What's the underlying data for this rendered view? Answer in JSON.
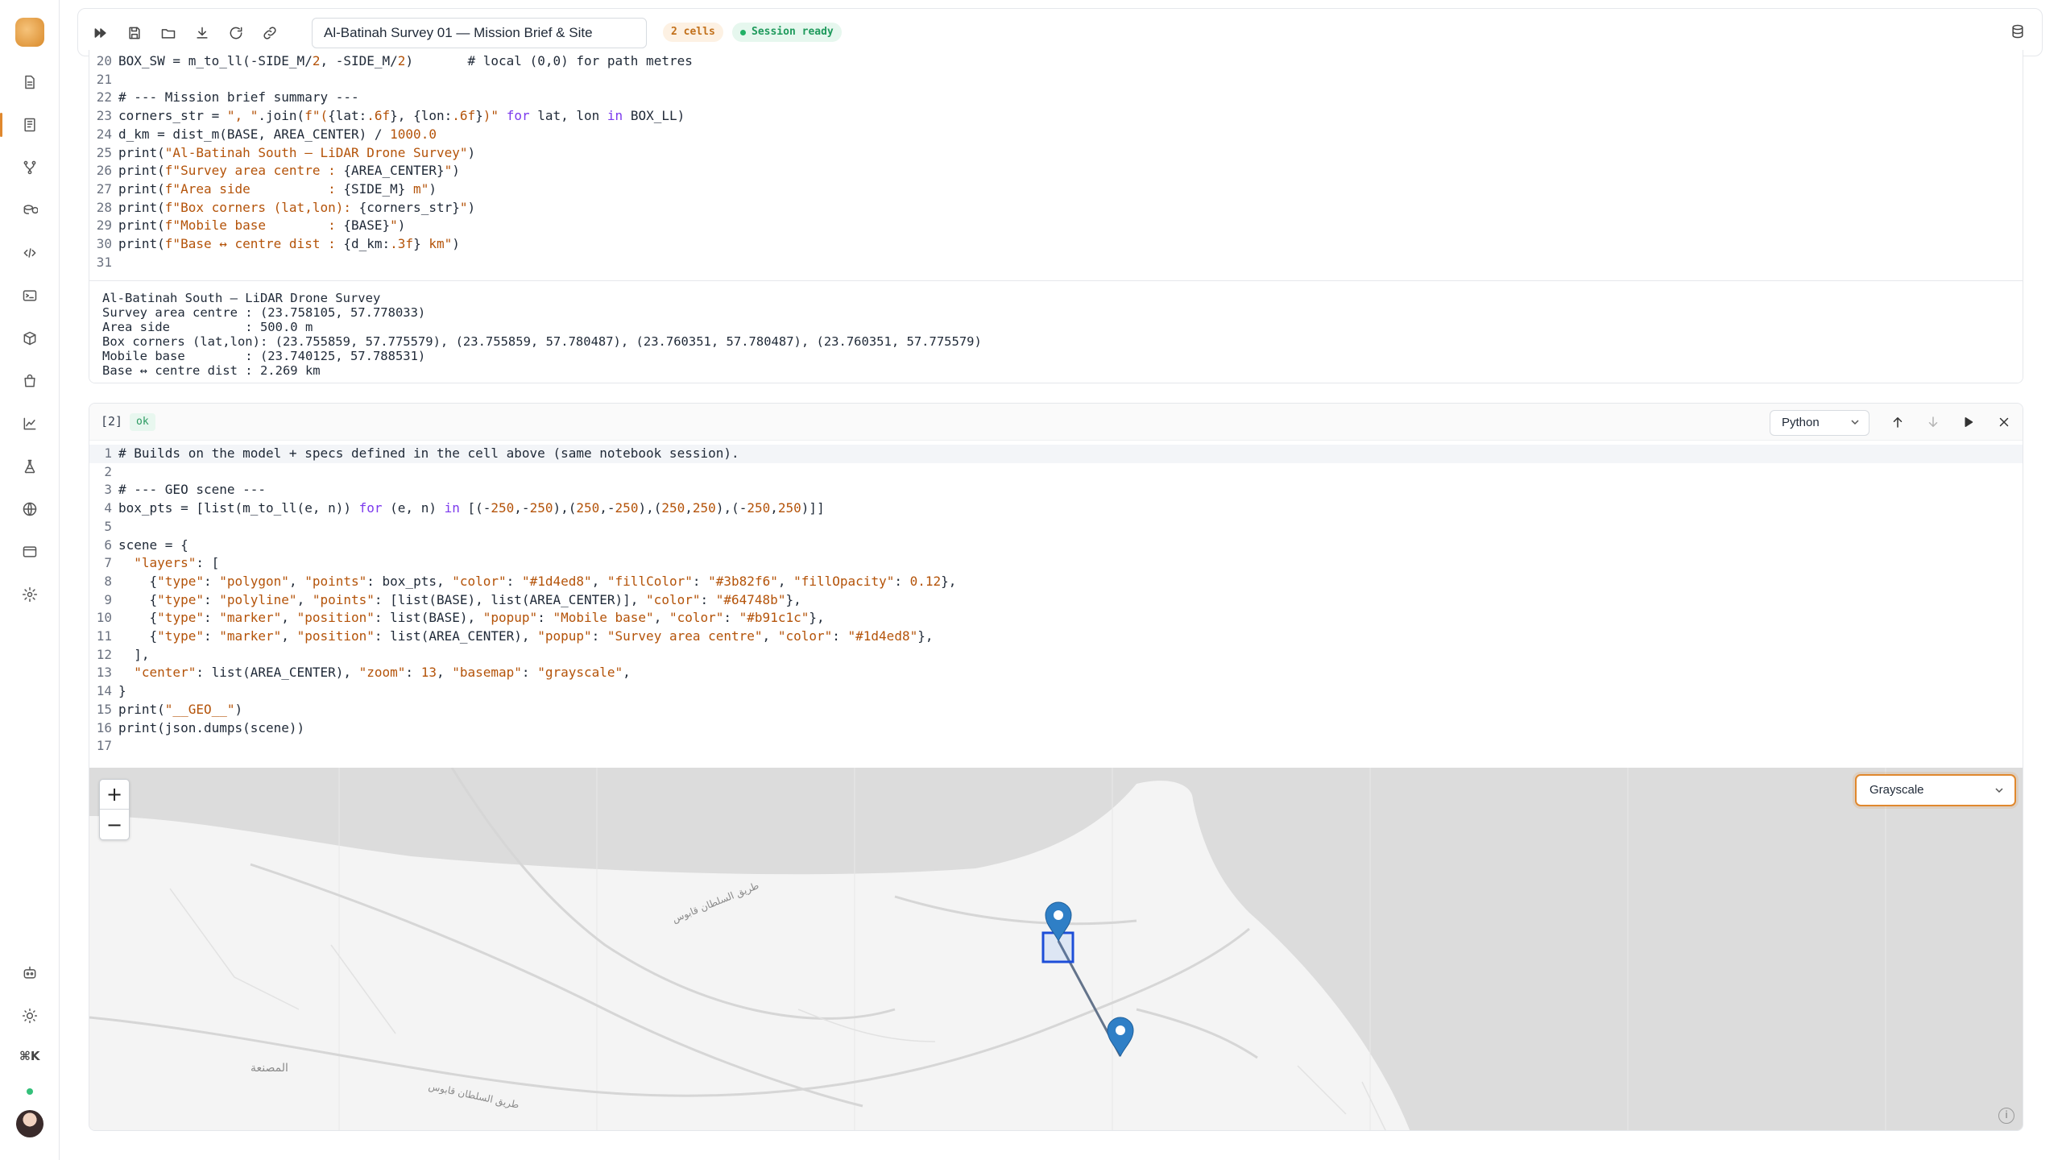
{
  "toolbar": {
    "notebook_title": "Al-Batinah Survey 01 — Mission Brief & Site",
    "cells_badge": "2 cells",
    "session_badge": "Session ready"
  },
  "cell1": {
    "code_lines": [
      {
        "n": "20",
        "html": "BOX_SW = m_to_ll(-SIDE_M/<span class=\"num\">2</span>, -SIDE_M/<span class=\"num\">2</span>)       # local (0,0) for path metres"
      },
      {
        "n": "21",
        "html": ""
      },
      {
        "n": "22",
        "html": "# --- Mission brief summary ---"
      },
      {
        "n": "23",
        "html": "corners_str = <span class=\"str\">\", \"</span>.join(<span class=\"str\">f\"(</span>{lat:<span class=\"num\">.6f</span>}, {lon:<span class=\"num\">.6f</span>}<span class=\"str\">)\"</span> <span class=\"kw\">for</span> lat, lon <span class=\"kw\">in</span> BOX_LL)"
      },
      {
        "n": "24",
        "html": "d_km = dist_m(BASE, AREA_CENTER) / <span class=\"num\">1000.0</span>"
      },
      {
        "n": "25",
        "html": "print(<span class=\"str\">\"Al-Batinah South — LiDAR Drone Survey\"</span>)"
      },
      {
        "n": "26",
        "html": "print(<span class=\"str\">f\"Survey area centre : </span>{AREA_CENTER}<span class=\"str\">\"</span>)"
      },
      {
        "n": "27",
        "html": "print(<span class=\"str\">f\"Area side          : </span>{SIDE_M}<span class=\"str\"> m\"</span>)"
      },
      {
        "n": "28",
        "html": "print(<span class=\"str\">f\"Box corners (lat,lon): </span>{corners_str}<span class=\"str\">\"</span>)"
      },
      {
        "n": "29",
        "html": "print(<span class=\"str\">f\"Mobile base        : </span>{BASE}<span class=\"str\">\"</span>)"
      },
      {
        "n": "30",
        "html": "print(<span class=\"str\">f\"Base ↔ centre dist : </span>{d_km:<span class=\"num\">.3f</span>}<span class=\"str\"> km\"</span>)"
      },
      {
        "n": "31",
        "html": ""
      }
    ],
    "output_lines": [
      "Al-Batinah South — LiDAR Drone Survey",
      "Survey area centre : (23.758105, 57.778033)",
      "Area side          : 500.0 m",
      "Box corners (lat,lon): (23.755859, 57.775579), (23.755859, 57.780487), (23.760351, 57.780487), (23.760351, 57.775579)",
      "Mobile base        : (23.740125, 57.788531)",
      "Base ↔ centre dist : 2.269 km"
    ]
  },
  "cell2": {
    "index": "[2]",
    "status": "ok",
    "language": "Python",
    "code_lines": [
      {
        "n": "1",
        "html": "# Builds on the model + specs defined in the cell above (same notebook session).",
        "hl": true
      },
      {
        "n": "2",
        "html": ""
      },
      {
        "n": "3",
        "html": "# --- GEO scene ---"
      },
      {
        "n": "4",
        "html": "box_pts = [list(m_to_ll(e, n)) <span class=\"kw\">for</span> (e, n) <span class=\"kw\">in</span> [(-<span class=\"num\">250</span>,-<span class=\"num\">250</span>),(<span class=\"num\">250</span>,-<span class=\"num\">250</span>),(<span class=\"num\">250</span>,<span class=\"num\">250</span>),(-<span class=\"num\">250</span>,<span class=\"num\">250</span>)]]"
      },
      {
        "n": "5",
        "html": ""
      },
      {
        "n": "6",
        "html": "scene = {"
      },
      {
        "n": "7",
        "html": "  <span class=\"str\">\"layers\"</span>: ["
      },
      {
        "n": "8",
        "html": "    {<span class=\"str\">\"type\"</span>: <span class=\"str\">\"polygon\"</span>, <span class=\"str\">\"points\"</span>: box_pts, <span class=\"str\">\"color\"</span>: <span class=\"str\">\"#1d4ed8\"</span>, <span class=\"str\">\"fillColor\"</span>: <span class=\"str\">\"#3b82f6\"</span>, <span class=\"str\">\"fillOpacity\"</span>: <span class=\"num\">0.12</span>},"
      },
      {
        "n": "9",
        "html": "    {<span class=\"str\">\"type\"</span>: <span class=\"str\">\"polyline\"</span>, <span class=\"str\">\"points\"</span>: [list(BASE), list(AREA_CENTER)], <span class=\"str\">\"color\"</span>: <span class=\"str\">\"#64748b\"</span>},"
      },
      {
        "n": "10",
        "html": "    {<span class=\"str\">\"type\"</span>: <span class=\"str\">\"marker\"</span>, <span class=\"str\">\"position\"</span>: list(BASE), <span class=\"str\">\"popup\"</span>: <span class=\"str\">\"Mobile base\"</span>, <span class=\"str\">\"color\"</span>: <span class=\"str\">\"#b91c1c\"</span>},"
      },
      {
        "n": "11",
        "html": "    {<span class=\"str\">\"type\"</span>: <span class=\"str\">\"marker\"</span>, <span class=\"str\">\"position\"</span>: list(AREA_CENTER), <span class=\"str\">\"popup\"</span>: <span class=\"str\">\"Survey area centre\"</span>, <span class=\"str\">\"color\"</span>: <span class=\"str\">\"#1d4ed8\"</span>},"
      },
      {
        "n": "12",
        "html": "  ],"
      },
      {
        "n": "13",
        "html": "  <span class=\"str\">\"center\"</span>: list(AREA_CENTER), <span class=\"str\">\"zoom\"</span>: <span class=\"num\">13</span>, <span class=\"str\">\"basemap\"</span>: <span class=\"str\">\"grayscale\"</span>,"
      },
      {
        "n": "14",
        "html": "}"
      },
      {
        "n": "15",
        "html": "print(<span class=\"str\">\"__GEO__\"</span>)"
      },
      {
        "n": "16",
        "html": "print(json.dumps(scene))"
      },
      {
        "n": "17",
        "html": ""
      }
    ]
  },
  "map": {
    "basemap_label": "Grayscale",
    "zoom_in": "+",
    "zoom_out": "−",
    "attribution_icon": "i",
    "place_labels": [
      "المصنعة",
      "طريق السلطان قابوس",
      "طريق السلطان قابوس"
    ],
    "colors": {
      "water": "#dcdcdc",
      "land": "#f7f7f7",
      "marker": "#2f7fc6",
      "box": "#1d4ed8",
      "line": "#64748b"
    }
  },
  "sidebar": {
    "shortcut": "⌘K",
    "icons": [
      "app-logo",
      "file-icon",
      "notebook-icon",
      "branch-icon",
      "database-icon",
      "code-icon",
      "terminal-icon",
      "package-icon",
      "shopping-bag-icon",
      "chart-icon",
      "flask-icon",
      "globe-icon",
      "window-icon",
      "settings-icon",
      "bot-icon",
      "sun-icon"
    ]
  }
}
